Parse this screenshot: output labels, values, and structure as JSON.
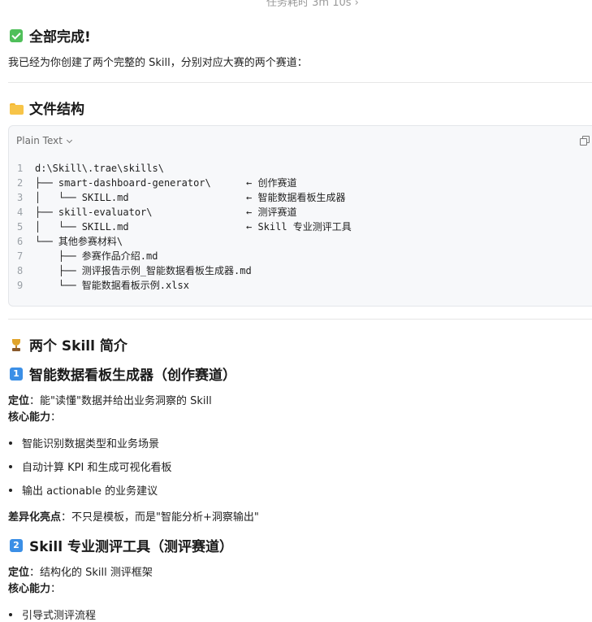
{
  "top_partial": "任务耗时 3m 10s ›",
  "done_heading": "全部完成!",
  "intro": "我已经为你创建了两个完整的 Skill，分别对应大赛的两个赛道：",
  "file_structure_heading": "文件结构",
  "code_block": {
    "language": "Plain Text",
    "lines": [
      {
        "n": "1",
        "text": "d:\\Skill\\.trae\\skills\\",
        "comment": ""
      },
      {
        "n": "2",
        "text": "├── smart-dashboard-generator\\",
        "comment": "← 创作赛道"
      },
      {
        "n": "3",
        "text": "│   └── SKILL.md",
        "comment": "← 智能数据看板生成器"
      },
      {
        "n": "4",
        "text": "├── skill-evaluator\\",
        "comment": "← 测评赛道"
      },
      {
        "n": "5",
        "text": "│   └── SKILL.md",
        "comment": "← Skill 专业测评工具"
      },
      {
        "n": "6",
        "text": "└── 其他参赛材料\\",
        "comment": ""
      },
      {
        "n": "7",
        "text": "    ├── 参赛作品介绍.md",
        "comment": ""
      },
      {
        "n": "8",
        "text": "    ├── 测评报告示例_智能数据看板生成器.md",
        "comment": ""
      },
      {
        "n": "9",
        "text": "    └── 智能数据看板示例.xlsx",
        "comment": ""
      }
    ]
  },
  "skills_heading": "两个 Skill 简介",
  "skill1": {
    "num": "1",
    "heading": "智能数据看板生成器（创作赛道）",
    "position_label": "定位",
    "position_text": "：能\"读懂\"数据并给出业务洞察的 Skill",
    "core_label": "核心能力",
    "core_suffix": "：",
    "bullets": [
      "智能识别数据类型和业务场景",
      "自动计算 KPI 和生成可视化看板",
      "输出 actionable 的业务建议"
    ],
    "highlight_label": "差异化亮点",
    "highlight_text": "：不只是模板，而是\"智能分析+洞察输出\""
  },
  "skill2": {
    "num": "2",
    "heading": "Skill 专业测评工具（测评赛道）",
    "position_label": "定位",
    "position_text": "：结构化的 Skill 测评框架",
    "core_label": "核心能力",
    "core_suffix": "：",
    "partial_bullet": "引导式测评流程"
  }
}
